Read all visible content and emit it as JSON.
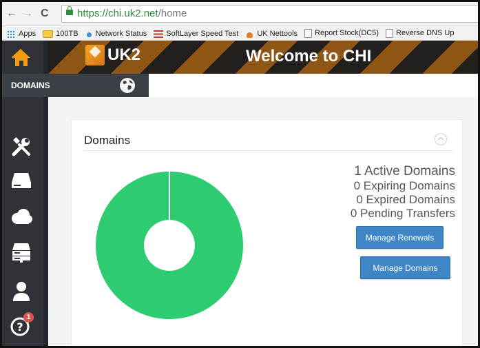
{
  "browser": {
    "back_label": "←",
    "forward_label": "→",
    "reload_label": "C",
    "url_host": "https://chi.uk2.net",
    "url_path": "/home"
  },
  "bookmarks": [
    {
      "label": "Apps",
      "icon": "apps-grid-icon"
    },
    {
      "label": "100TB",
      "icon": "folder-icon"
    },
    {
      "label": "Network Status",
      "icon": "droplet-icon"
    },
    {
      "label": "SoftLayer Speed Test",
      "icon": "softlayer-icon"
    },
    {
      "label": "UK Nettools",
      "icon": "nettools-icon"
    },
    {
      "label": "Report Stock(DC5)",
      "icon": "page-icon"
    },
    {
      "label": "Reverse DNS Up",
      "icon": "page-icon"
    }
  ],
  "banner": {
    "logo_text": "UK2",
    "title": "Welcome to CHI"
  },
  "sidebar": {
    "section_label": "DOMAINS",
    "icons": [
      "home-icon",
      "tools-icon",
      "server-icon",
      "cloud-icon",
      "rack-server-icon",
      "user-icon",
      "help-icon"
    ],
    "help_badge": "1"
  },
  "panel": {
    "title": "Domains",
    "stats": [
      "1 Active Domains",
      "0 Expiring Domains",
      "0 Expired Domains",
      "0 Pending Transfers"
    ],
    "manage_renewals": "Manage Renewals",
    "manage_domains": "Manage Domains"
  },
  "chart_data": {
    "type": "pie",
    "categories": [
      "Active",
      "Expiring",
      "Expired",
      "Pending"
    ],
    "values": [
      1,
      0,
      0,
      0
    ],
    "colors": [
      "#2ecc71"
    ],
    "hole": true
  },
  "colors": {
    "accent": "#f39c12",
    "sidebar": "#2f3338",
    "button": "#3f86c6",
    "donut": "#2ecc71"
  }
}
